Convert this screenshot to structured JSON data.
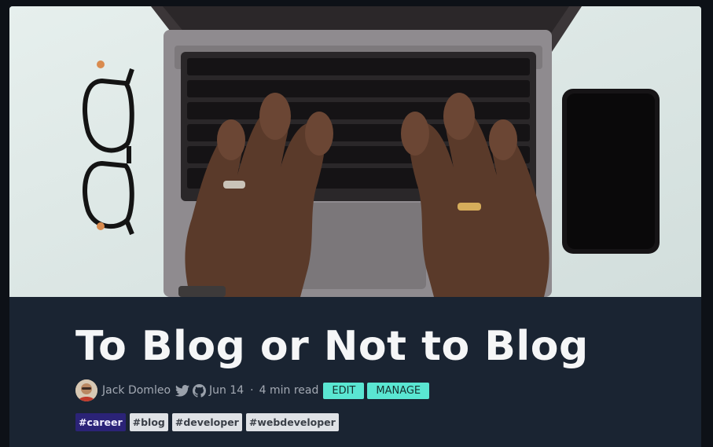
{
  "post": {
    "title": "To Blog or Not to Blog",
    "author": "Jack Domleo",
    "date": "Jun 14",
    "separator": "·",
    "read_time": "4 min read"
  },
  "actions": {
    "edit_label": "EDIT",
    "manage_label": "MANAGE"
  },
  "tags": [
    {
      "label": "#career",
      "color": "#2b2377"
    },
    {
      "label": "#blog",
      "color": "#dfe2e6"
    },
    {
      "label": "#developer",
      "color": "#dfe2e6"
    },
    {
      "label": "#webdeveloper",
      "color": "#dfe2e6"
    }
  ],
  "colors": {
    "page_bg": "#0d1117",
    "card_bg": "#1a2432",
    "button_accent": "#5ae6d2"
  },
  "icons": [
    "twitter-icon",
    "github-icon"
  ]
}
